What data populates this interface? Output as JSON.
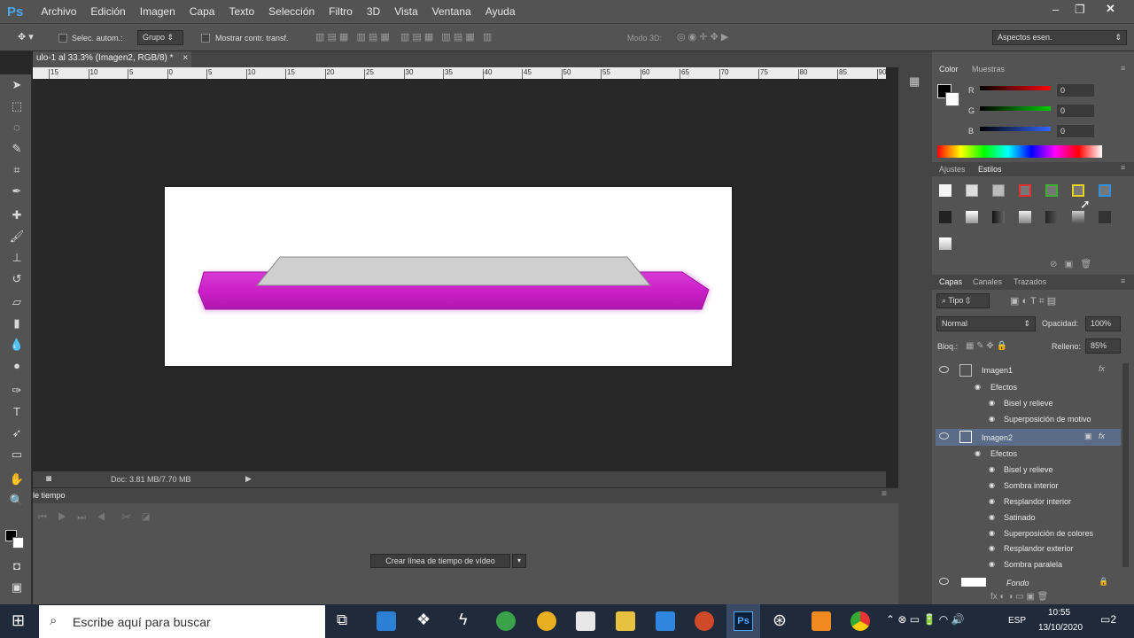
{
  "app": {
    "logo": "Ps",
    "menu": [
      "Archivo",
      "Edición",
      "Imagen",
      "Capa",
      "Texto",
      "Selección",
      "Filtro",
      "3D",
      "Vista",
      "Ventana",
      "Ayuda"
    ]
  },
  "options": {
    "auto_select_label": "Selec. autom.:",
    "auto_select_value": "Grupo",
    "show_transform_label": "Mostrar contr. transf.",
    "mode3d_label": "Modo 3D:",
    "workspace": "Aspectos esen."
  },
  "document": {
    "tab_title": "ulo-1 al 33.3% (Imagen2, RGB/8) *",
    "tab_close": "×",
    "ruler_ticks": [
      "15",
      "10",
      "5",
      "0",
      "5",
      "10",
      "15",
      "20",
      "25",
      "30",
      "35",
      "40",
      "45",
      "50",
      "55",
      "60",
      "65",
      "70",
      "75",
      "80",
      "85",
      "90"
    ],
    "status": "Doc: 3.81 MB/7.70 MB"
  },
  "timeline": {
    "tab": "le tiempo",
    "create_button": "Crear línea de tiempo de vídeo"
  },
  "color_panel": {
    "tabs": [
      "Color",
      "Muestras"
    ],
    "channels": [
      {
        "label": "R",
        "value": "0"
      },
      {
        "label": "G",
        "value": "0"
      },
      {
        "label": "B",
        "value": "0"
      }
    ]
  },
  "styles_panel": {
    "tabs": [
      "Ajustes",
      "Estilos"
    ]
  },
  "layers_panel": {
    "tabs": [
      "Capas",
      "Canales",
      "Trazados"
    ],
    "filter": "Tipo",
    "blend_mode": "Normal",
    "opacity_label": "Opacidad:",
    "opacity_value": "100%",
    "lock_label": "Bloq.:",
    "fill_label": "Relleno:",
    "fill_value": "85%",
    "layers": [
      {
        "name": "Imagen1",
        "effects_label": "Efectos",
        "effects": [
          "Bisel y relieve",
          "Superposición de motivo"
        ]
      },
      {
        "name": "Imagen2",
        "effects_label": "Efectos",
        "effects": [
          "Bisel y relieve",
          "Sombra interior",
          "Resplandor interior",
          "Satinado",
          "Superposición de colores",
          "Resplandor exterior",
          "Sombra paralela"
        ]
      },
      {
        "name": "Fondo"
      }
    ]
  },
  "taskbar": {
    "search_placeholder": "Escribe aquí para buscar",
    "lang": "ESP",
    "time": "10:55",
    "date": "13/10/2020",
    "notifications": "2"
  },
  "colors": {
    "magenta_bar": "#cc20c8",
    "gray_bar": "#cfcfcf",
    "ps_blue": "#4ea6ff"
  }
}
